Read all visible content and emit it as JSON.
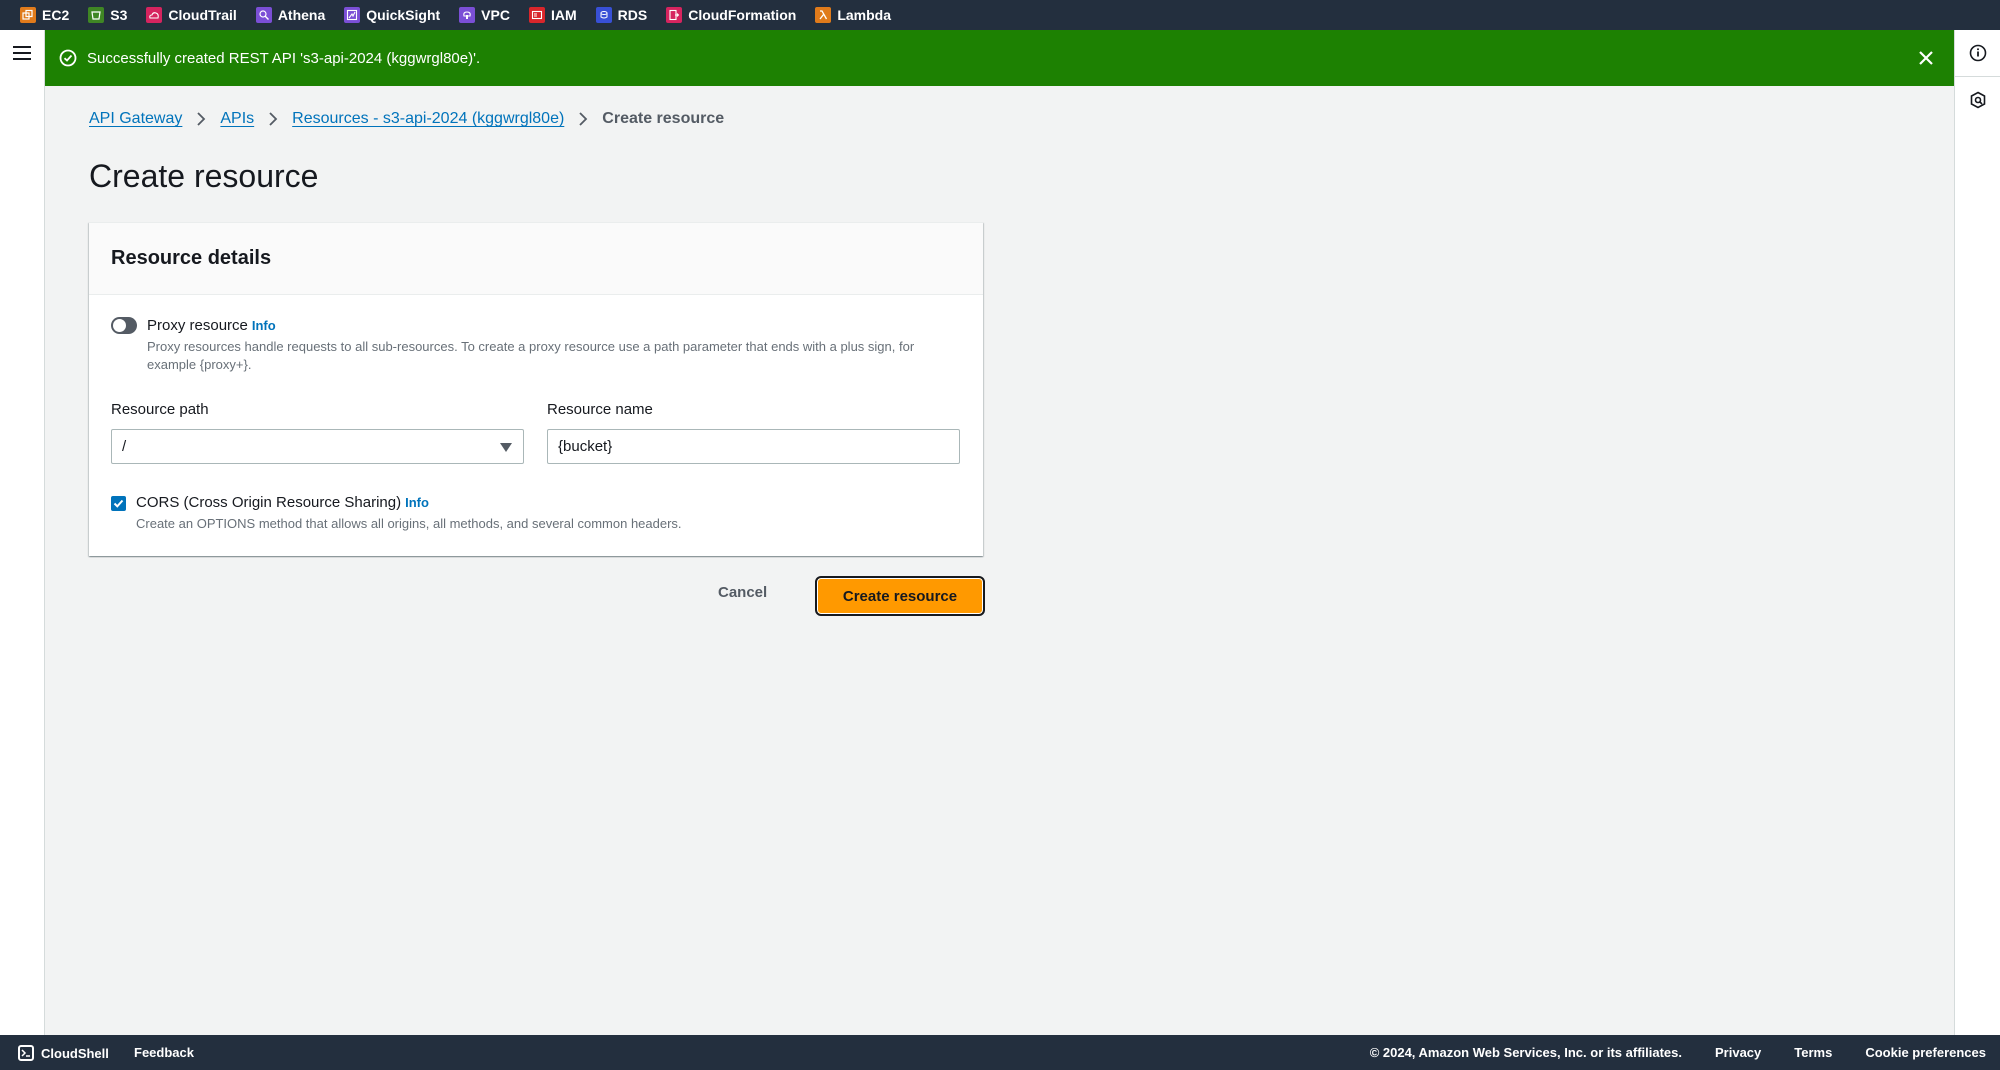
{
  "services_bar": [
    {
      "label": "EC2",
      "icon": "ec2-icon",
      "color": "#e07b1b"
    },
    {
      "label": "S3",
      "icon": "s3-icon",
      "color": "#3f8624"
    },
    {
      "label": "CloudTrail",
      "icon": "cloudtrail-icon",
      "color": "#d6245f"
    },
    {
      "label": "Athena",
      "icon": "athena-icon",
      "color": "#7b4fd6"
    },
    {
      "label": "QuickSight",
      "icon": "quicksight-icon",
      "color": "#7b4fd6"
    },
    {
      "label": "VPC",
      "icon": "vpc-icon",
      "color": "#7b4fd6"
    },
    {
      "label": "IAM",
      "icon": "iam-icon",
      "color": "#d9262b"
    },
    {
      "label": "RDS",
      "icon": "rds-icon",
      "color": "#3850d6"
    },
    {
      "label": "CloudFormation",
      "icon": "cloudformation-icon",
      "color": "#d6245f"
    },
    {
      "label": "Lambda",
      "icon": "lambda-icon",
      "color": "#e07b1b"
    }
  ],
  "flash": {
    "message": "Successfully created REST API 's3-api-2024 (kggwrgl80e)'.",
    "color": "#1d8102"
  },
  "breadcrumb": {
    "items": [
      "API Gateway",
      "APIs",
      "Resources - s3-api-2024 (kggwrgl80e)"
    ],
    "current": "Create resource"
  },
  "page": {
    "title": "Create resource"
  },
  "form": {
    "section_title": "Resource details",
    "proxy": {
      "label": "Proxy resource",
      "info": "Info",
      "enabled": false,
      "description": "Proxy resources handle requests to all sub-resources. To create a proxy resource use a path parameter that ends with a plus sign, for example {proxy+}."
    },
    "resource_path": {
      "label": "Resource path",
      "value": "/"
    },
    "resource_name": {
      "label": "Resource name",
      "value": "{bucket}"
    },
    "cors": {
      "label": "CORS (Cross Origin Resource Sharing)",
      "info": "Info",
      "checked": true,
      "description": "Create an OPTIONS method that allows all origins, all methods, and several common headers."
    }
  },
  "actions": {
    "cancel": "Cancel",
    "submit": "Create resource",
    "primary_color": "#ff9900"
  },
  "footer": {
    "cloudshell": "CloudShell",
    "feedback": "Feedback",
    "copyright": "© 2024, Amazon Web Services, Inc. or its affiliates.",
    "links": [
      "Privacy",
      "Terms",
      "Cookie preferences"
    ]
  }
}
